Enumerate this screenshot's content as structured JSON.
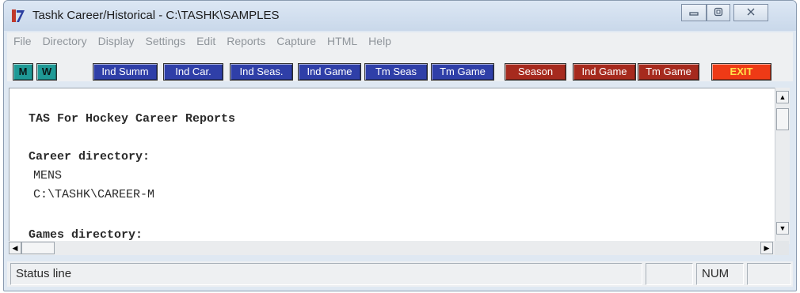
{
  "window": {
    "title": "Tashk Career/Historical - C:\\TASHK\\SAMPLES",
    "controls": [
      "minimize-icon",
      "restore-icon",
      "close-icon"
    ]
  },
  "menu": [
    "File",
    "Directory",
    "Display",
    "Settings",
    "Edit",
    "Reports",
    "Capture",
    "HTML",
    "Help"
  ],
  "toolbar": {
    "buttons": [
      {
        "label": "M",
        "color": "#1f9a96"
      },
      {
        "label": "W",
        "color": "#1f9a96"
      },
      {
        "label": "Ind Summ",
        "color": "#2f3fa8"
      },
      {
        "label": "Ind Car.",
        "color": "#2f3fa8"
      },
      {
        "label": "Ind Seas.",
        "color": "#2f3fa8"
      },
      {
        "label": "Ind Game",
        "color": "#2f3fa8"
      },
      {
        "label": "Tm Seas",
        "color": "#2f3fa8"
      },
      {
        "label": "Tm Game",
        "color": "#2f3fa8"
      },
      {
        "label": "Season",
        "color": "#a62a1e"
      },
      {
        "label": "Ind Game",
        "color": "#a62a1e"
      },
      {
        "label": "Tm Game",
        "color": "#a62a1e"
      },
      {
        "label": "EXIT",
        "color": "#ee3a16"
      }
    ]
  },
  "report": {
    "heading": "TAS For Hockey Career Reports",
    "career_label": "Career directory:",
    "career_name": "MENS",
    "career_path": "C:\\TASHK\\CAREER-M",
    "games_label": "Games directory:"
  },
  "status": {
    "text": "Status line",
    "num": "NUM"
  }
}
